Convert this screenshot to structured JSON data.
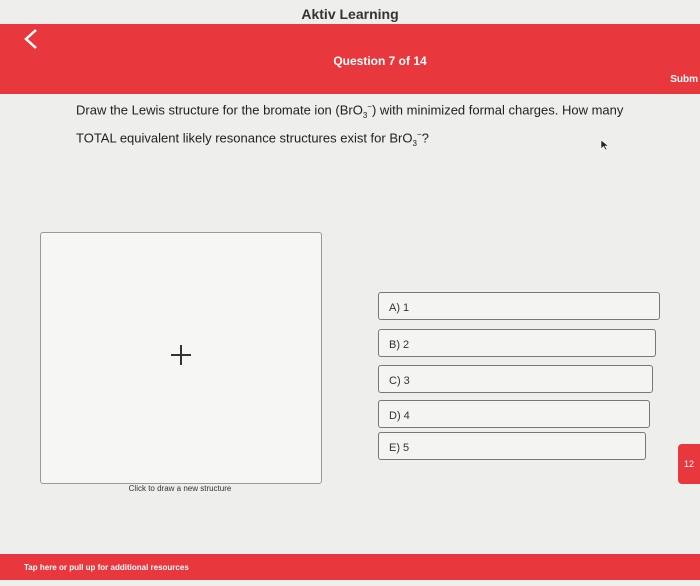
{
  "app": {
    "title": "Aktiv Learning"
  },
  "header": {
    "question_counter": "Question 7 of 14",
    "submit_label": "Subm",
    "back_icon": "chevron-left-icon"
  },
  "question": {
    "text_part1": "Draw the Lewis structure for the bromate ion (BrO",
    "sub1": "3",
    "sup1": "−",
    "text_part2": ") with minimized formal charges. How many TOTAL equivalent likely resonance structures exist for BrO",
    "sub2": "3",
    "sup2": "−",
    "text_part3": "?"
  },
  "drawing": {
    "caption": "Click to draw a new structure",
    "icon": "plus-icon"
  },
  "options": [
    {
      "label": "A) 1"
    },
    {
      "label": "B) 2"
    },
    {
      "label": "C) 3"
    },
    {
      "label": "D) 4"
    },
    {
      "label": "E) 5"
    }
  ],
  "side_badge": {
    "value": "12"
  },
  "footer": {
    "resources_label": "Tap here or pull up for additional resources"
  },
  "colors": {
    "accent": "#e8383e",
    "background": "#eeeeec"
  }
}
